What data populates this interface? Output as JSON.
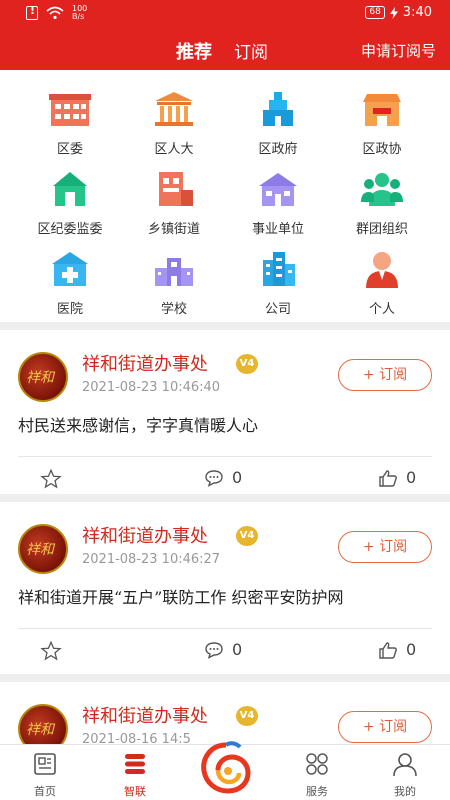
{
  "status": {
    "speed": "100\nB/s",
    "battery": "68",
    "time": "3:40"
  },
  "header": {
    "tabs": [
      {
        "label": "推荐"
      },
      {
        "label": "订阅"
      }
    ],
    "apply_label": "申请订阅号"
  },
  "categories": [
    {
      "label": "区委",
      "icon": "government-building-icon"
    },
    {
      "label": "区人大",
      "icon": "congress-hall-icon"
    },
    {
      "label": "区政府",
      "icon": "government-office-icon"
    },
    {
      "label": "区政协",
      "icon": "consultative-building-icon"
    },
    {
      "label": "区纪委监委",
      "icon": "discipline-house-icon"
    },
    {
      "label": "乡镇街道",
      "icon": "street-office-icon"
    },
    {
      "label": "事业单位",
      "icon": "institution-house-icon"
    },
    {
      "label": "群团组织",
      "icon": "group-people-icon"
    },
    {
      "label": "医院",
      "icon": "hospital-icon"
    },
    {
      "label": "学校",
      "icon": "school-icon"
    },
    {
      "label": "公司",
      "icon": "company-towers-icon"
    },
    {
      "label": "个人",
      "icon": "person-icon"
    }
  ],
  "posts": [
    {
      "author": "祥和街道办事处",
      "badge": "V4",
      "date": "2021-08-23 10:46:40",
      "title": "村民送来感谢信，字字真情暖人心",
      "subscribe_label": "+ 订阅",
      "comments": "0",
      "likes": "0"
    },
    {
      "author": "祥和街道办事处",
      "badge": "V4",
      "date": "2021-08-23 10:46:27",
      "title": "祥和街道开展“五户”联防工作 织密平安防护网",
      "subscribe_label": "+ 订阅",
      "comments": "0",
      "likes": "0"
    },
    {
      "author": "祥和街道办事处",
      "badge": "V4",
      "date": "2021-08-16 14:5",
      "subscribe_label": "+ 订阅"
    }
  ],
  "nav": [
    {
      "label": "首页",
      "icon": "news-icon"
    },
    {
      "label": "智联",
      "icon": "zhilian-icon"
    },
    {
      "label": "服务",
      "icon": "grid-services-icon"
    },
    {
      "label": "我的",
      "icon": "user-icon"
    }
  ],
  "colors": {
    "brand_red": "#e0231f",
    "accent_orange": "#e25c33",
    "badge_gold": "#e8b62c"
  }
}
